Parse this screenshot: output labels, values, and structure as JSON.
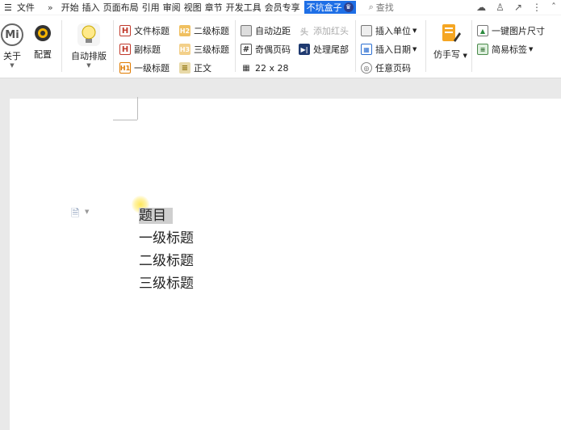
{
  "menubar": {
    "hamburger": "☰",
    "file": "文件",
    "more": "»",
    "tabs": [
      "开始",
      "插入",
      "页面布局",
      "引用",
      "审阅",
      "视图",
      "章节",
      "开发工具",
      "会员专享"
    ],
    "active_tab": "不坑盒子",
    "search": "查找"
  },
  "ribbon": {
    "about": "关于",
    "config": "配置",
    "auto_layout": "自动排版",
    "styles": {
      "doc_title": "文件标题",
      "sub_title": "副标题",
      "h1": "一级标题",
      "h2": "二级标题",
      "h3": "三级标题",
      "body": "正文"
    },
    "page_tools": {
      "auto_margin": "自动边距",
      "odd_even_page": "奇偶页码",
      "grid": "22 x 28",
      "add_header": "添加红头",
      "handle_tail": "处理尾部"
    },
    "insert_tools": {
      "insert_unit": "插入单位",
      "insert_date": "插入日期",
      "any_page_num": "任意页码"
    },
    "imitate_write": "仿手写",
    "one_click_img": "一键图片尺寸",
    "simple_tag": "简易标签"
  },
  "document": {
    "lines": [
      "题目",
      "一级标题",
      "二级标题",
      "三级标题"
    ]
  }
}
